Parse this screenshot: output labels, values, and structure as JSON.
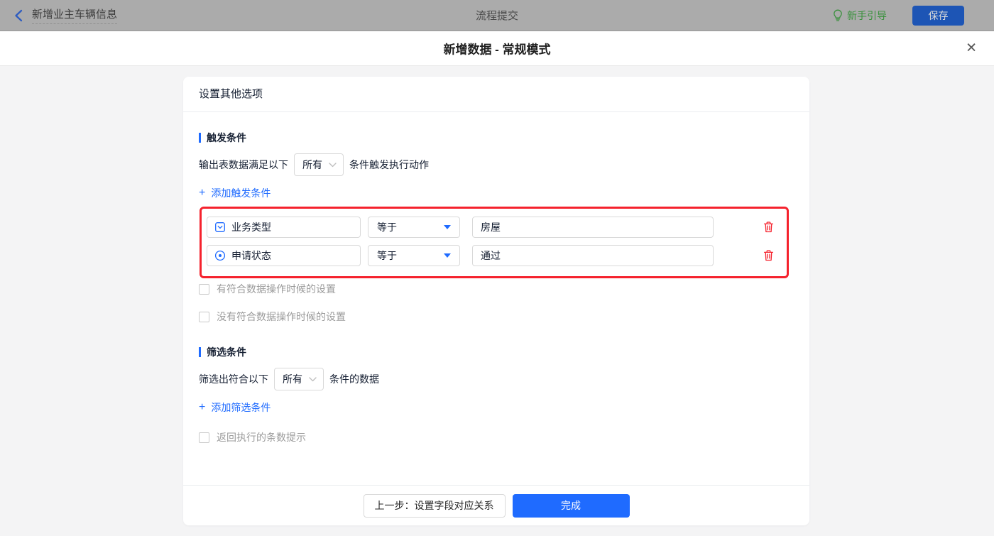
{
  "topbar": {
    "back_label": "新增业主车辆信息",
    "center_title": "流程提交",
    "guide_label": "新手引导",
    "save_label": "保存"
  },
  "dialog": {
    "title": "新增数据 - 常规模式",
    "close_glyph": "✕"
  },
  "card": {
    "header": "设置其他选项",
    "trigger": {
      "section_title": "触发条件",
      "sentence_prefix": "输出表数据满足以下",
      "match_select": "所有",
      "sentence_suffix": "条件触发执行动作",
      "add_plus": "+",
      "add_label": "添加触发条件",
      "conditions": [
        {
          "field": "业务类型",
          "field_icon": "select-field-icon",
          "operator": "等于",
          "value": "房屋"
        },
        {
          "field": "申请状态",
          "field_icon": "radio-field-icon",
          "operator": "等于",
          "value": "通过"
        }
      ],
      "checkbox_has_match": "有符合数据操作时候的设置",
      "checkbox_no_match": "没有符合数据操作时候的设置"
    },
    "filter": {
      "section_title": "筛选条件",
      "sentence_prefix": "筛选出符合以下",
      "match_select": "所有",
      "sentence_suffix": "条件的数据",
      "add_plus": "+",
      "add_label": "添加筛选条件",
      "checkbox_count_tip": "返回执行的条数提示"
    },
    "footer": {
      "prev_label": "上一步：设置字段对应关系",
      "done_label": "完成"
    }
  },
  "icons": {
    "back": "chevron-left",
    "guide": "lightbulb",
    "close": "x",
    "field_type_1": "dropdown-select-field",
    "field_type_2": "radio-field",
    "operator_caret": "caret-down-filled",
    "select_arrow": "chevron-down",
    "delete": "trash"
  },
  "colors": {
    "accent_blue": "#1f6bff",
    "annotation_red": "#f5222d",
    "guide_green": "#3a913d",
    "dimmed_topbar_bg": "#ababab",
    "body_bg": "#f4f4f5",
    "muted_label": "#9b9b9b"
  }
}
